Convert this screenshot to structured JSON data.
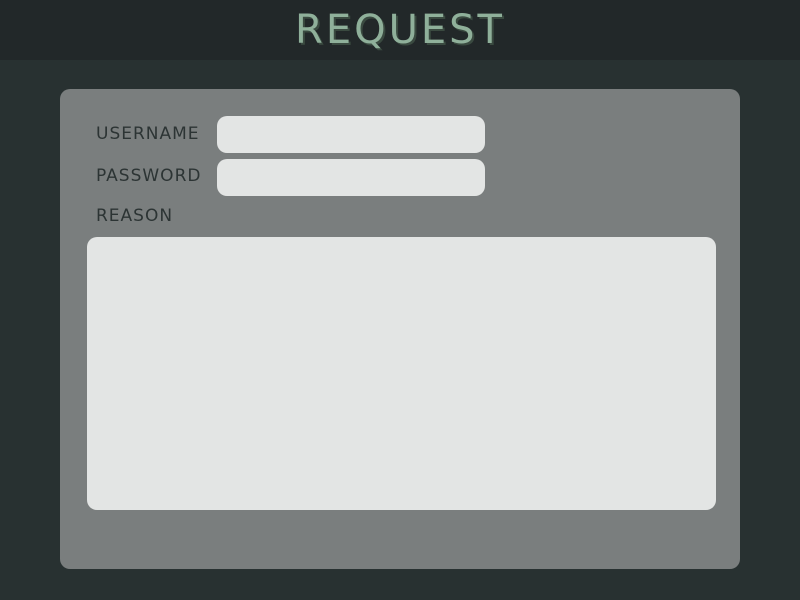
{
  "header": {
    "title": "REQUEST"
  },
  "form": {
    "username": {
      "label": "USERNAME",
      "value": "",
      "placeholder": ""
    },
    "password": {
      "label": "PASSWORD",
      "value": "",
      "placeholder": ""
    },
    "reason": {
      "label": "REASON",
      "value": "",
      "placeholder": ""
    }
  },
  "colors": {
    "page_background": "#283131",
    "header_background": "#222829",
    "title_accent": "#8fb09a",
    "panel_background": "#7a7e7e",
    "field_background": "#e3e5e4",
    "label_text": "#2c3434"
  }
}
